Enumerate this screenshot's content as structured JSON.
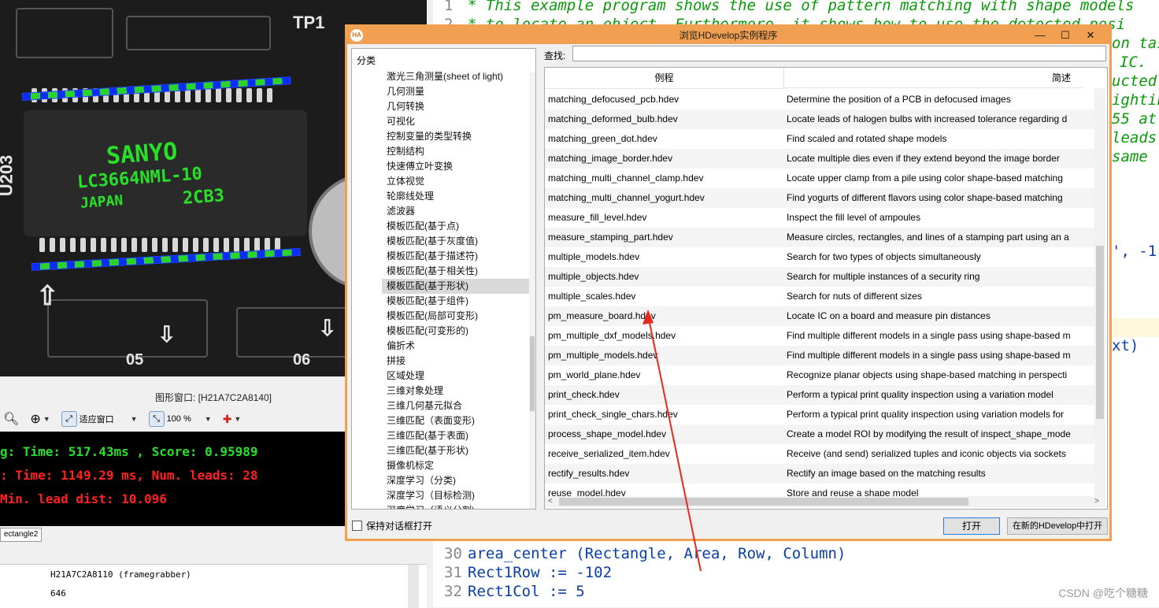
{
  "pcb": {
    "chip_brand": "SANYO",
    "chip_part": "LC3664NML-10",
    "chip_origin": "JAPAN",
    "chip_code": "2CB3",
    "silk_tp1": "TP1",
    "silk_u203": "U203",
    "silk_05": "05",
    "silk_06": "06",
    "lead_color_a": "#0a2cff",
    "lead_color_b": "#2bd42b"
  },
  "graphics_window": {
    "title": "图形窗口: [H21A7C2A8140]",
    "fit_label": "适应窗口",
    "zoom_label": "100 %",
    "console_lines": [
      {
        "text": "g: Time: 517.43ms , Score: 0.95989",
        "color": "#29e029"
      },
      {
        "text": ":  Time: 1149.29 ms, Num. leads: 28",
        "color": "#ff2020"
      },
      {
        "text": "   Min. lead dist: 10.096",
        "color": "#ff2020"
      }
    ],
    "tab_label": "ectangle2",
    "var_rows": [
      "H21A7C2A8110 (framegrabber)",
      "646"
    ]
  },
  "editor": {
    "lines_top": [
      {
        "num": "1",
        "text": "* This example program shows the use of pattern matching with shape models"
      },
      {
        "num": "2",
        "text": "* to locate an object.  Furthermore, it shows how to use the detected posi"
      }
    ],
    "right_fragments": [
      "on tas",
      "IC.",
      "ucted",
      "ighting",
      "55 at",
      "leads",
      "same",
      "', -1,",
      "xt)"
    ],
    "lines_bottom": [
      {
        "num": "30",
        "text": "area_center (Rectangle, Area, Row, Column)"
      },
      {
        "num": "31",
        "text": "Rect1Row := -102"
      },
      {
        "num": "32",
        "text": "Rect1Col := 5"
      }
    ],
    "watermark": "CSDN @吃个糖糖"
  },
  "dialog": {
    "title": "浏览HDevelop实例程序",
    "logo": "HA",
    "min": "—",
    "max": "☐",
    "close": "✕",
    "category_header": "分类",
    "categories": [
      "激光三角测量(sheet of light)",
      "几何测量",
      "几何转换",
      "可视化",
      "控制变量的类型转换",
      "控制结构",
      "快速傅立叶变换",
      "立体视觉",
      "轮廓线处理",
      "滤波器",
      "模板匹配(基于点)",
      "模板匹配(基于灰度值)",
      "模板匹配(基于描述符)",
      "模板匹配(基于相关性)",
      "模板匹配(基于形状)",
      "模板匹配(基于组件)",
      "模板匹配(局部可变形)",
      "模板匹配(可变形的)",
      "偏折术",
      "拼接",
      "区域处理",
      "三维对象处理",
      "三维几何基元拟合",
      "三维匹配（表面变形)",
      "三维匹配(基于表面)",
      "三维匹配(基于形状)",
      "摄像机标定",
      "深度学习（分类)",
      "深度学习（目标检测)",
      "深度学习（语义分割)"
    ],
    "selected_category_index": 14,
    "search_label": "查找:",
    "search_value": "",
    "col_example": "例程",
    "col_desc": "简述",
    "rows": [
      {
        "name": "matching_defocused_pcb.hdev",
        "desc": "Determine the position of a PCB in defocused images"
      },
      {
        "name": "matching_deformed_bulb.hdev",
        "desc": "Locate leads of halogen bulbs with increased tolerance regarding d"
      },
      {
        "name": "matching_green_dot.hdev",
        "desc": "Find scaled and rotated shape models"
      },
      {
        "name": "matching_image_border.hdev",
        "desc": "Locate multiple dies even if they extend beyond the image border"
      },
      {
        "name": "matching_multi_channel_clamp.hdev",
        "desc": "Locate upper clamp from a pile using color shape-based matching"
      },
      {
        "name": "matching_multi_channel_yogurt.hdev",
        "desc": "Find yogurts of different flavors using color shape-based matching"
      },
      {
        "name": "measure_fill_level.hdev",
        "desc": "Inspect the fill level of ampoules"
      },
      {
        "name": "measure_stamping_part.hdev",
        "desc": "Measure circles, rectangles, and lines of a stamping part using an a"
      },
      {
        "name": "multiple_models.hdev",
        "desc": "Search for two types of objects simultaneously"
      },
      {
        "name": "multiple_objects.hdev",
        "desc": "Search for multiple instances of a security ring"
      },
      {
        "name": "multiple_scales.hdev",
        "desc": "Search for nuts of different sizes"
      },
      {
        "name": "pm_measure_board.hdev",
        "desc": "Locate IC on a board and measure pin distances"
      },
      {
        "name": "pm_multiple_dxf_models.hdev",
        "desc": "Find multiple different models in a single pass using shape-based m"
      },
      {
        "name": "pm_multiple_models.hdev",
        "desc": "Find multiple different models in a single pass using shape-based m"
      },
      {
        "name": "pm_world_plane.hdev",
        "desc": "Recognize planar objects using shape-based matching in perspecti"
      },
      {
        "name": "print_check.hdev",
        "desc": "Perform a typical print quality inspection using a variation model"
      },
      {
        "name": "print_check_single_chars.hdev",
        "desc": "Perform a typical print quality inspection using variation models for"
      },
      {
        "name": "process_shape_model.hdev",
        "desc": "Create a model ROI by modifying the result of inspect_shape_mode"
      },
      {
        "name": "receive_serialized_item.hdev",
        "desc": "Receive (and send) serialized tuples and iconic objects via sockets"
      },
      {
        "name": "rectify_results.hdev",
        "desc": "Rectify an image based on the matching results"
      },
      {
        "name": "reuse_model.hdev",
        "desc": "Store and reuse a shape model"
      }
    ],
    "keep_open_label": "保持对话框打开",
    "open_label": "打开",
    "open_new_label": "在新的HDevelop中打开",
    "arrow_color": "#e8281e"
  }
}
